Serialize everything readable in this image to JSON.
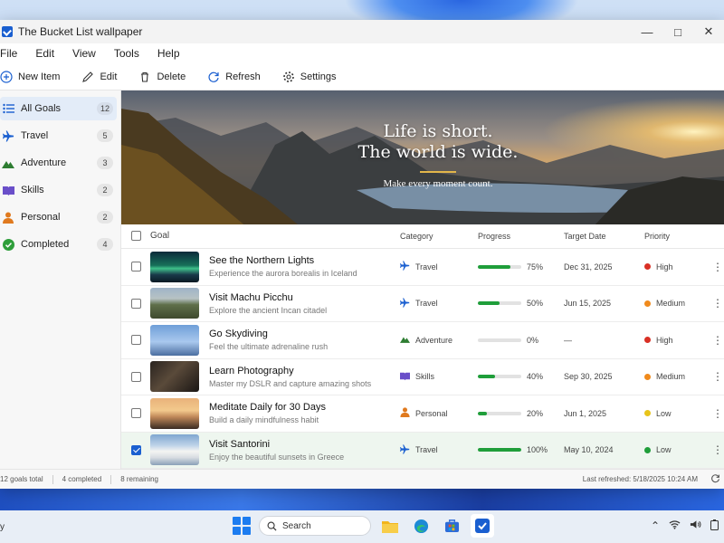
{
  "window": {
    "title": "The Bucket List wallpaper"
  },
  "menu": [
    "File",
    "Edit",
    "View",
    "Tools",
    "Help"
  ],
  "toolbar": {
    "new_item": "New Item",
    "edit": "Edit",
    "delete": "Delete",
    "refresh": "Refresh",
    "settings": "Settings"
  },
  "sidebar": {
    "items": [
      {
        "label": "All Goals",
        "count": "12",
        "icon": "list-icon",
        "color": "#1a5fd0"
      },
      {
        "label": "Travel",
        "count": "5",
        "icon": "airplane-icon",
        "color": "#1a5fd0"
      },
      {
        "label": "Adventure",
        "count": "3",
        "icon": "mountain-icon",
        "color": "#2e7d32"
      },
      {
        "label": "Skills",
        "count": "2",
        "icon": "book-icon",
        "color": "#6a4fc9"
      },
      {
        "label": "Personal",
        "count": "2",
        "icon": "person-icon",
        "color": "#e07a1f"
      },
      {
        "label": "Completed",
        "count": "4",
        "icon": "check-circle-icon",
        "color": "#2e9e3a"
      }
    ]
  },
  "banner": {
    "line1": "Life is short.",
    "line2": "The world is wide.",
    "subtitle": "Make every moment count."
  },
  "table": {
    "headers": {
      "goal": "Goal",
      "category": "Category",
      "progress": "Progress",
      "target": "Target Date",
      "priority": "Priority"
    },
    "rows": [
      {
        "title": "See the Northern Lights",
        "desc": "Experience the aurora borealis in Iceland",
        "category": "Travel",
        "cat_icon": "airplane-icon",
        "progress": 75,
        "progress_label": "75%",
        "date": "Dec 31, 2025",
        "priority": "High",
        "priority_color": "#d93025",
        "checked": false,
        "thumb": "aurora"
      },
      {
        "title": "Visit Machu Picchu",
        "desc": "Explore the ancient Incan citadel",
        "category": "Travel",
        "cat_icon": "airplane-icon",
        "progress": 50,
        "progress_label": "50%",
        "date": "Jun 15, 2025",
        "priority": "Medium",
        "priority_color": "#f08a1c",
        "checked": false,
        "thumb": "mountain"
      },
      {
        "title": "Go Skydiving",
        "desc": "Feel the ultimate adrenaline rush",
        "category": "Adventure",
        "cat_icon": "mountain-icon",
        "progress": 0,
        "progress_label": "0%",
        "date": "—",
        "priority": "High",
        "priority_color": "#d93025",
        "checked": false,
        "thumb": "sky"
      },
      {
        "title": "Learn Photography",
        "desc": "Master my DSLR and capture amazing shots",
        "category": "Skills",
        "cat_icon": "book-icon",
        "progress": 40,
        "progress_label": "40%",
        "date": "Sep 30, 2025",
        "priority": "Medium",
        "priority_color": "#f08a1c",
        "checked": false,
        "thumb": "camera"
      },
      {
        "title": "Meditate Daily for 30 Days",
        "desc": "Build a daily mindfulness habit",
        "category": "Personal",
        "cat_icon": "person-icon",
        "progress": 20,
        "progress_label": "20%",
        "date": "Jun 1, 2025",
        "priority": "Low",
        "priority_color": "#e8c41a",
        "checked": false,
        "thumb": "sunset"
      },
      {
        "title": "Visit Santorini",
        "desc": "Enjoy the beautiful sunsets in Greece",
        "category": "Travel",
        "cat_icon": "airplane-icon",
        "progress": 100,
        "progress_label": "100%",
        "date": "May 10, 2024",
        "priority": "Low",
        "priority_color": "#1f9e3a",
        "checked": true,
        "thumb": "santorini"
      }
    ]
  },
  "status": {
    "total": "12 goals total",
    "completed": "4 completed",
    "remaining": "8 remaining",
    "refreshed": "Last refreshed:  5/18/2025  10:24 AM"
  },
  "taskbar": {
    "left_text": "y",
    "search_label": "Search"
  },
  "colors": {
    "accent": "#1a5fd0",
    "progress": "#1f9e3a"
  }
}
